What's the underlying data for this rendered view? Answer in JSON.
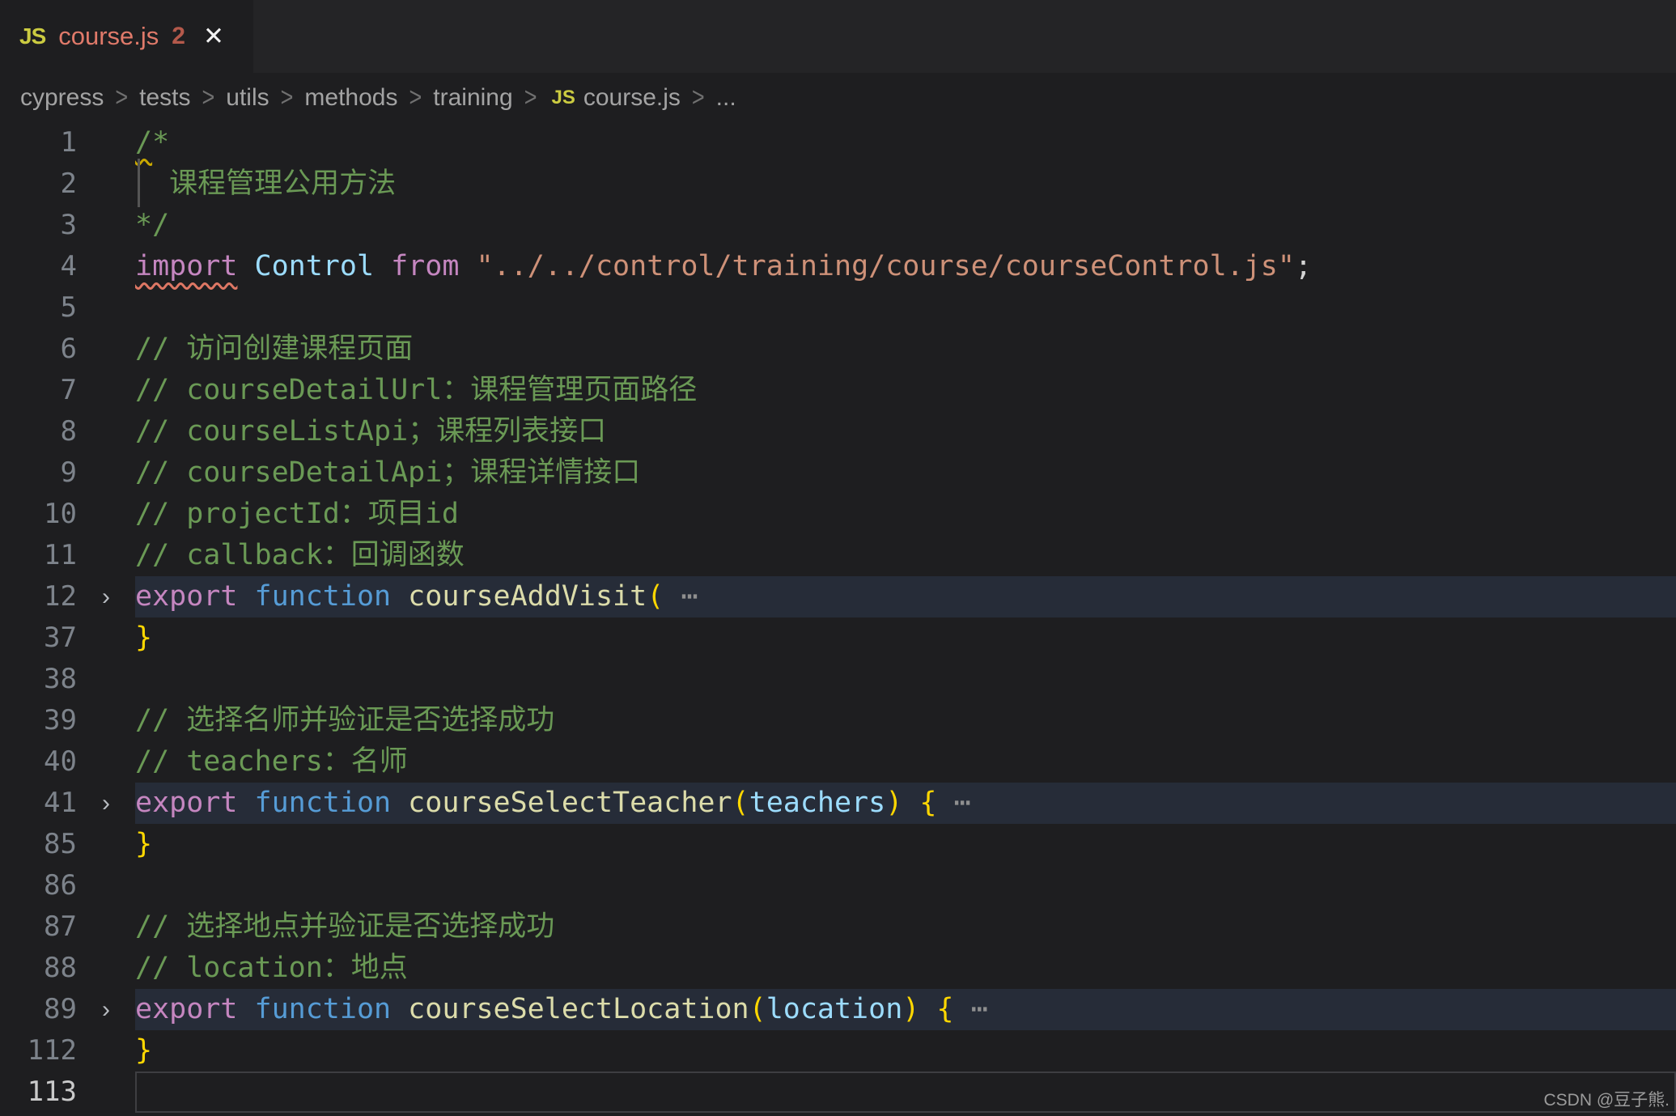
{
  "theme": {
    "editor_bg": "#1e1e20",
    "tabstrip_bg": "#242426",
    "tab_error_label": "#e07a6a",
    "tab_badge": "#b4594b",
    "js_icon": "#cbcb41",
    "comment": "#6a9955",
    "keyword": "#c586c0",
    "keyword_control": "#569cd6",
    "function_name": "#dcdcaa",
    "variable": "#9cdcfe",
    "string": "#ce9178",
    "bracket": "#ffd700",
    "folded_line_bg": "#262c38",
    "warning_squiggle": "#c9a800",
    "error_squiggle": "#de7764"
  },
  "tab": {
    "icon": "JS",
    "label": "course.js",
    "badge": "2",
    "close": "✕"
  },
  "breadcrumb": {
    "items": [
      "cypress",
      "tests",
      "utils",
      "methods",
      "training"
    ],
    "separator": ">",
    "file_icon": "JS",
    "file": "course.js",
    "more": "..."
  },
  "watermark": "CSDN @豆子熊.",
  "editor": {
    "lines": [
      {
        "n": "1",
        "tokens": [
          {
            "t": "/",
            "c": "cm",
            "sq": "y"
          },
          {
            "t": "*",
            "c": "cm"
          }
        ]
      },
      {
        "n": "2",
        "guide": true,
        "tokens": [
          {
            "t": "  课程管理公用方法",
            "c": "cm"
          }
        ]
      },
      {
        "n": "3",
        "tokens": [
          {
            "t": "*/",
            "c": "cm"
          }
        ]
      },
      {
        "n": "4",
        "tokens": [
          {
            "t": "import",
            "c": "kw",
            "sq": "r"
          },
          {
            "t": " ",
            "c": "pun"
          },
          {
            "t": "Control",
            "c": "var"
          },
          {
            "t": " ",
            "c": "pun"
          },
          {
            "t": "from",
            "c": "kw"
          },
          {
            "t": " ",
            "c": "pun"
          },
          {
            "t": "\"../../control/training/course/courseControl.js\"",
            "c": "str"
          },
          {
            "t": ";",
            "c": "pun"
          }
        ]
      },
      {
        "n": "5",
        "tokens": []
      },
      {
        "n": "6",
        "tokens": [
          {
            "t": "// 访问创建课程页面",
            "c": "cm"
          }
        ]
      },
      {
        "n": "7",
        "tokens": [
          {
            "t": "// courseDetailUrl：课程管理页面路径",
            "c": "cm"
          }
        ]
      },
      {
        "n": "8",
        "tokens": [
          {
            "t": "// courseListApi；课程列表接口",
            "c": "cm"
          }
        ]
      },
      {
        "n": "9",
        "tokens": [
          {
            "t": "// courseDetailApi；课程详情接口",
            "c": "cm"
          }
        ]
      },
      {
        "n": "10",
        "tokens": [
          {
            "t": "// projectId：项目id",
            "c": "cm"
          }
        ]
      },
      {
        "n": "11",
        "tokens": [
          {
            "t": "// callback：回调函数",
            "c": "cm"
          }
        ]
      },
      {
        "n": "12",
        "fold": true,
        "hl": true,
        "tokens": [
          {
            "t": "export",
            "c": "kw"
          },
          {
            "t": " ",
            "c": "pun"
          },
          {
            "t": "function",
            "c": "kw2"
          },
          {
            "t": " ",
            "c": "pun"
          },
          {
            "t": "courseAddVisit",
            "c": "fn"
          },
          {
            "t": "(",
            "c": "brk"
          },
          {
            "t": " ⋯",
            "c": "ell"
          }
        ]
      },
      {
        "n": "37",
        "tokens": [
          {
            "t": "}",
            "c": "brk"
          }
        ]
      },
      {
        "n": "38",
        "tokens": []
      },
      {
        "n": "39",
        "tokens": [
          {
            "t": "// 选择名师并验证是否选择成功",
            "c": "cm"
          }
        ]
      },
      {
        "n": "40",
        "tokens": [
          {
            "t": "// teachers：名师",
            "c": "cm"
          }
        ]
      },
      {
        "n": "41",
        "fold": true,
        "hl": true,
        "tokens": [
          {
            "t": "export",
            "c": "kw"
          },
          {
            "t": " ",
            "c": "pun"
          },
          {
            "t": "function",
            "c": "kw2"
          },
          {
            "t": " ",
            "c": "pun"
          },
          {
            "t": "courseSelectTeacher",
            "c": "fn"
          },
          {
            "t": "(",
            "c": "brk"
          },
          {
            "t": "teachers",
            "c": "var"
          },
          {
            "t": ")",
            "c": "brk"
          },
          {
            "t": " ",
            "c": "pun"
          },
          {
            "t": "{",
            "c": "brk"
          },
          {
            "t": " ⋯",
            "c": "ell"
          }
        ]
      },
      {
        "n": "85",
        "tokens": [
          {
            "t": "}",
            "c": "brk"
          }
        ]
      },
      {
        "n": "86",
        "tokens": []
      },
      {
        "n": "87",
        "tokens": [
          {
            "t": "// 选择地点并验证是否选择成功",
            "c": "cm"
          }
        ]
      },
      {
        "n": "88",
        "tokens": [
          {
            "t": "// location：地点",
            "c": "cm"
          }
        ]
      },
      {
        "n": "89",
        "fold": true,
        "hl": true,
        "tokens": [
          {
            "t": "export",
            "c": "kw"
          },
          {
            "t": " ",
            "c": "pun"
          },
          {
            "t": "function",
            "c": "kw2"
          },
          {
            "t": " ",
            "c": "pun"
          },
          {
            "t": "courseSelectLocation",
            "c": "fn"
          },
          {
            "t": "(",
            "c": "brk"
          },
          {
            "t": "location",
            "c": "var"
          },
          {
            "t": ")",
            "c": "brk"
          },
          {
            "t": " ",
            "c": "pun"
          },
          {
            "t": "{",
            "c": "brk"
          },
          {
            "t": " ⋯",
            "c": "ell"
          }
        ]
      },
      {
        "n": "112",
        "tokens": [
          {
            "t": "}",
            "c": "brk"
          }
        ]
      },
      {
        "n": "113",
        "cur": true,
        "tokens": []
      }
    ],
    "fold_chevron": "›"
  }
}
